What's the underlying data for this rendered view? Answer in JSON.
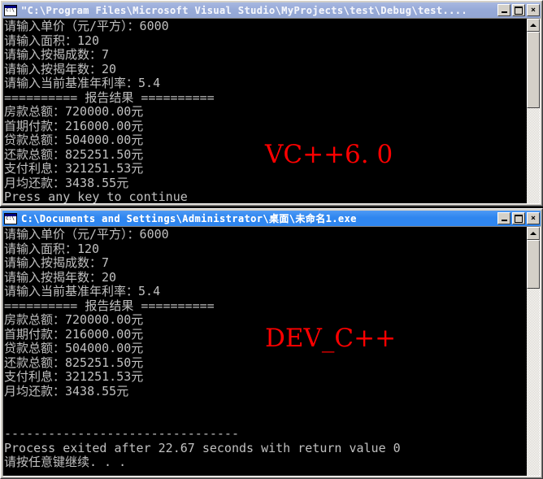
{
  "windows": [
    {
      "id": "vc6",
      "title": "\"C:\\Program Files\\Microsoft Visual Studio\\MyProjects\\test\\Debug\\test....",
      "state": "inactive",
      "buttons": {
        "minimize": "–",
        "maximize": "□",
        "close": "×"
      },
      "watermark": "VC++6. 0",
      "lines": [
        "请输入单价（元/平方）：6000",
        "请输入面积：120",
        "请输入按揭成数：7",
        "请输入按揭年数：20",
        "请输入当前基准年利率：5.4",
        "========== 报告结果 ==========",
        "房款总额：720000.00元",
        "首期付款：216000.00元",
        "贷款总额：504000.00元",
        "还款总额：825251.50元",
        "支付利息：321251.53元",
        "月均还款：3438.55元",
        "Press any key to continue"
      ]
    },
    {
      "id": "devcpp",
      "title": "C:\\Documents and Settings\\Administrator\\桌面\\未命名1.exe",
      "state": "active",
      "buttons": {
        "minimize": "–",
        "maximize": "□",
        "close": "×"
      },
      "watermark": "DEV_C++",
      "lines": [
        "请输入单价（元/平方）：6000",
        "请输入面积：120",
        "请输入按揭成数：7",
        "请输入按揭年数：20",
        "请输入当前基准年利率：5.4",
        "========== 报告结果 ==========",
        "房款总额：720000.00元",
        "首期付款：216000.00元",
        "贷款总额：504000.00元",
        "还款总额：825251.50元",
        "支付利息：321251.53元",
        "月均还款：3438.55元",
        "",
        "",
        "--------------------------------",
        "Process exited after 22.67 seconds with return value 0",
        "请按任意键继续. . ."
      ]
    }
  ],
  "colors": {
    "title_active": "#2f86ef",
    "title_inactive": "#97aad8",
    "console_bg": "#000000",
    "console_fg": "#c0c0c0",
    "watermark": "#ff0000",
    "chrome": "#d4d0c8"
  }
}
